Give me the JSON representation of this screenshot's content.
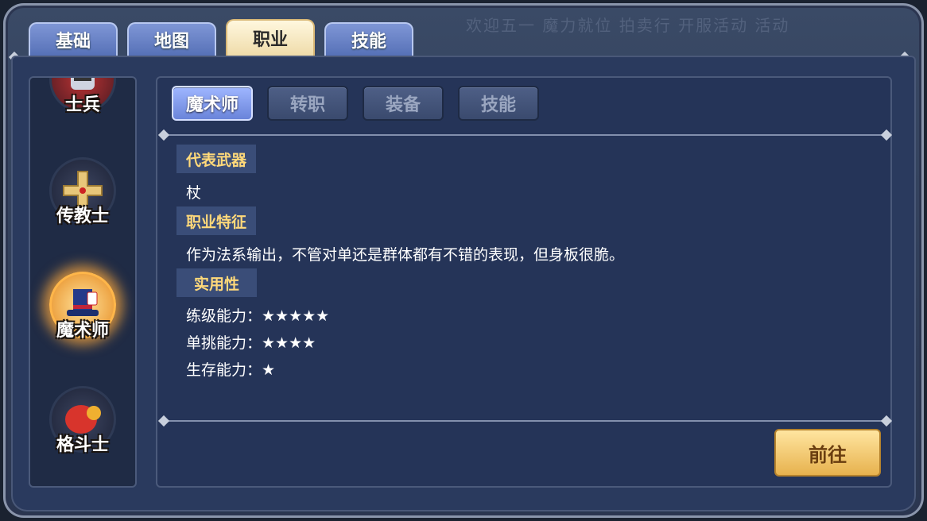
{
  "top_tabs": [
    "基础",
    "地图",
    "职业",
    "技能"
  ],
  "background_text": "欢迎五一 魔力就位 拍卖行 开服活动 活动",
  "sidebar": {
    "items": [
      {
        "label": "士兵",
        "icon": "soldier-helmet-icon"
      },
      {
        "label": "传教士",
        "icon": "priest-cross-icon"
      },
      {
        "label": "魔术师",
        "icon": "magician-hat-icon",
        "selected": true
      },
      {
        "label": "格斗士",
        "icon": "boxing-glove-icon"
      }
    ]
  },
  "sub_tabs": [
    "魔术师",
    "转职",
    "装备",
    "技能"
  ],
  "details": {
    "weapon_label": "代表武器",
    "weapon_value": "杖",
    "trait_label": "职业特征",
    "trait_value": "作为法系输出，不管对单还是群体都有不错的表现，但身板很脆。",
    "utility_label": "实用性",
    "leveling": "练级能力：★★★★★",
    "solo": "单挑能力：★★★★",
    "survival": "生存能力：★"
  },
  "go_button": "前往",
  "colors": {
    "accent_gold": "#ffd97a",
    "active_subtab": "#7f98ea"
  }
}
